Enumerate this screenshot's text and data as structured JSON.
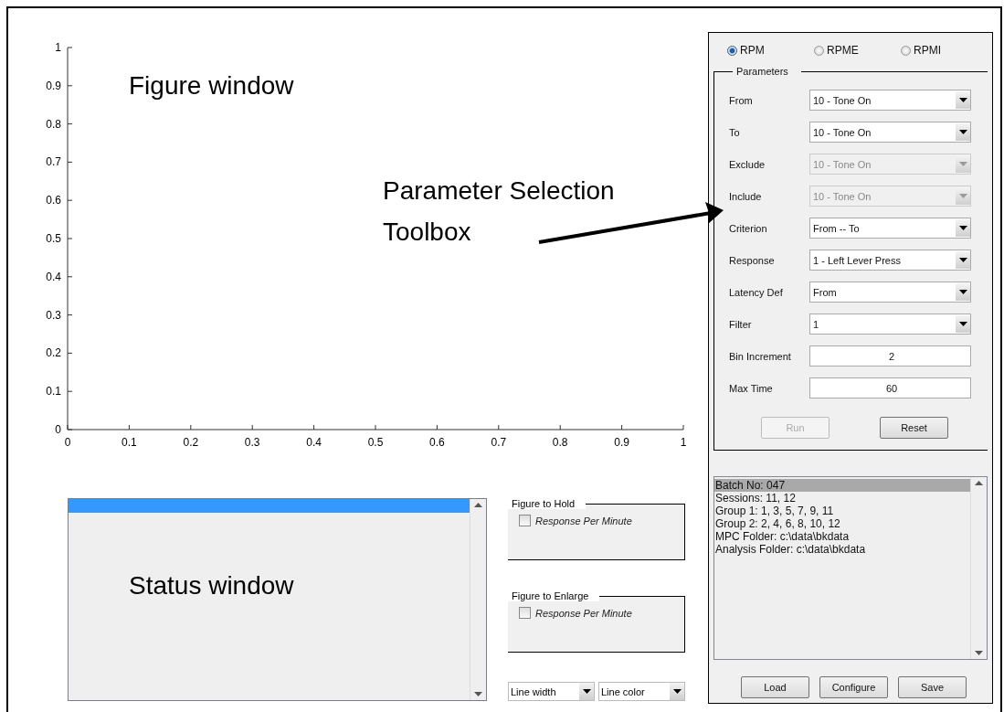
{
  "figure": {
    "chart_data": {
      "type": "line",
      "xlim": [
        0,
        1
      ],
      "ylim": [
        0,
        1
      ],
      "xticks": [
        0,
        0.1,
        0.2,
        0.3,
        0.4,
        0.5,
        0.6,
        0.7,
        0.8,
        0.9,
        1
      ],
      "yticks": [
        0,
        0.1,
        0.2,
        0.3,
        0.4,
        0.5,
        0.6,
        0.7,
        0.8,
        0.9,
        1
      ]
    }
  },
  "status_window": {
    "rows": [
      {
        "selected": true
      }
    ]
  },
  "figure_to_hold": {
    "title": "Figure to Hold",
    "checkbox": {
      "label": "Response Per Minute",
      "checked": false
    }
  },
  "figure_to_enlarge": {
    "title": "Figure to Enlarge",
    "checkbox": {
      "label": "Response Per Minute",
      "checked": false
    }
  },
  "line_dropdowns": [
    {
      "value": "Line width"
    },
    {
      "value": "Line color"
    }
  ],
  "modes": [
    {
      "label": "RPM",
      "selected": true
    },
    {
      "label": "RPME",
      "selected": false
    },
    {
      "label": "RPMI",
      "selected": false
    }
  ],
  "parameters": {
    "title": "Parameters",
    "fields": [
      {
        "label": "From",
        "kind": "dropdown",
        "value": "10 - Tone On",
        "disabled": false
      },
      {
        "label": "To",
        "kind": "dropdown",
        "value": "10 - Tone On",
        "disabled": false
      },
      {
        "label": "Exclude",
        "kind": "dropdown",
        "value": "10 - Tone On",
        "disabled": true
      },
      {
        "label": "Include",
        "kind": "dropdown",
        "value": "10 - Tone On",
        "disabled": true
      },
      {
        "label": "Criterion",
        "kind": "dropdown",
        "value": "From -- To",
        "disabled": false
      },
      {
        "label": "Response",
        "kind": "dropdown",
        "value": "1 - Left Lever Press",
        "disabled": false
      },
      {
        "label": "Latency Def",
        "kind": "dropdown",
        "value": "From",
        "disabled": false
      },
      {
        "label": "Filter",
        "kind": "dropdown",
        "value": "1",
        "disabled": false
      },
      {
        "label": "Bin Increment",
        "kind": "number",
        "value": "2",
        "disabled": false
      },
      {
        "label": "Max Time",
        "kind": "number",
        "value": "60",
        "disabled": false
      }
    ],
    "buttons": [
      {
        "label": "Run",
        "disabled": true
      },
      {
        "label": "Reset",
        "disabled": false
      }
    ]
  },
  "batch_info": [
    {
      "text": "Batch No: 047",
      "selected": true
    },
    {
      "text": "Sessions: 11, 12",
      "selected": false
    },
    {
      "text": "Group 1: 1, 3, 5, 7, 9, 11",
      "selected": false
    },
    {
      "text": "Group 2: 2, 4, 6, 8, 10, 12",
      "selected": false
    },
    {
      "text": "MPC Folder: c:\\data\\bkdata",
      "selected": false
    },
    {
      "text": "Analysis Folder: c:\\data\\bkdata",
      "selected": false
    }
  ],
  "bottom_buttons": [
    "Load",
    "Configure",
    "Save"
  ],
  "annotations": [
    {
      "text": "Figure window"
    },
    {
      "text": "Status window"
    },
    {
      "text": "Parameter Selection"
    },
    {
      "text": "Toolbox"
    }
  ]
}
